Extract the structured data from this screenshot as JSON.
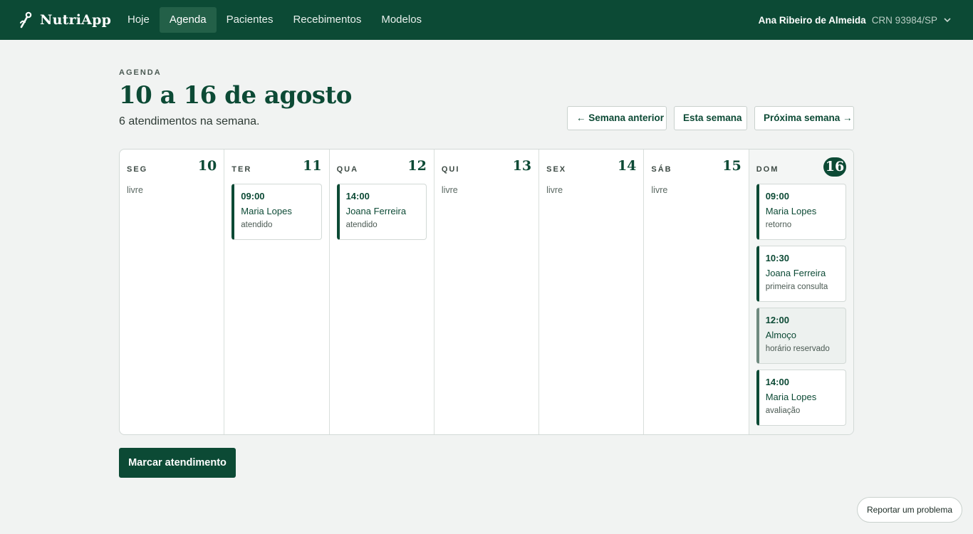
{
  "app": {
    "name": "NutriApp",
    "nav": [
      {
        "label": "Hoje"
      },
      {
        "label": "Agenda"
      },
      {
        "label": "Pacientes"
      },
      {
        "label": "Recebimentos"
      },
      {
        "label": "Modelos"
      }
    ],
    "active_nav": "Agenda",
    "user": {
      "name": "Ana Ribeiro de Almeida",
      "crn": "CRN 93984/SP"
    }
  },
  "header": {
    "eyebrow": "AGENDA",
    "title": "10 a 16 de agosto",
    "subtitle": "6 atendimentos na semana."
  },
  "week_nav": {
    "prev": "← Semana anterior",
    "current": "Esta semana",
    "next": "Próxima semana →"
  },
  "days": [
    {
      "dow": "SEG",
      "num": "10",
      "free": "livre"
    },
    {
      "dow": "TER",
      "num": "11",
      "appointments": [
        {
          "time": "09:00",
          "name": "Maria Lopes",
          "status": "atendido"
        }
      ]
    },
    {
      "dow": "QUA",
      "num": "12",
      "appointments": [
        {
          "time": "14:00",
          "name": "Joana Ferreira",
          "status": "atendido"
        }
      ]
    },
    {
      "dow": "QUI",
      "num": "13",
      "free": "livre"
    },
    {
      "dow": "SEX",
      "num": "14",
      "free": "livre"
    },
    {
      "dow": "SÁB",
      "num": "15",
      "free": "livre"
    },
    {
      "dow": "DOM",
      "num": "16",
      "today": true,
      "appointments": [
        {
          "time": "09:00",
          "name": "Maria Lopes",
          "status": "retorno"
        },
        {
          "time": "10:30",
          "name": "Joana Ferreira",
          "status": "primeira consulta"
        },
        {
          "time": "12:00",
          "name": "Almoço",
          "status": "horário reservado"
        },
        {
          "time": "14:00",
          "name": "Maria Lopes",
          "status": "avaliação"
        }
      ]
    }
  ],
  "actions": {
    "new_appointment": "Marcar atendimento",
    "report": "Reportar um problema"
  },
  "colors": {
    "brand": "#0c4a35",
    "nav_active": "#236048",
    "background": "#f1f3f2"
  }
}
